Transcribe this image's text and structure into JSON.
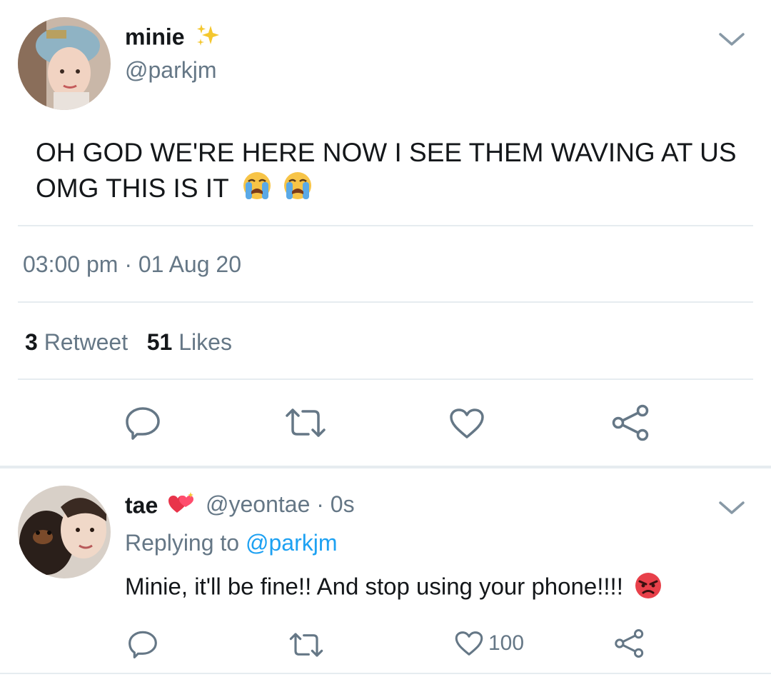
{
  "main_tweet": {
    "display_name": "minie",
    "name_emoji": "sparkles-icon",
    "handle": "@parkjm",
    "text": "OH GOD WE'RE HERE NOW I SEE THEM WAVING AT US OMG THIS IS IT",
    "text_emojis": [
      "loudly-crying-face-icon",
      "loudly-crying-face-icon"
    ],
    "time": "03:00 pm",
    "date_sep": "·",
    "date": "01 Aug 20",
    "retweet_count": "3",
    "retweet_label": "Retweet",
    "likes_count": "51",
    "likes_label": "Likes"
  },
  "reply_tweet": {
    "display_name": "tae",
    "name_emoji": "heart-with-sparkles-icon",
    "handle": "@yeontae",
    "sep": "·",
    "age": "0s",
    "replying_prefix": "Replying to",
    "replying_handle": "@parkjm",
    "text": "Minie, it'll be fine!! And stop using your phone!!!!",
    "text_emoji": "angry-face-icon",
    "like_count": "100"
  },
  "colors": {
    "text": "#14171a",
    "secondary": "#657786",
    "link": "#1da1f2",
    "divider": "#e6ecf0"
  }
}
